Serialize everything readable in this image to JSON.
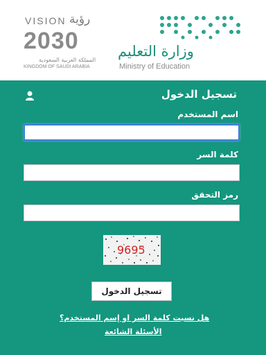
{
  "header": {
    "vision_word": "VISION",
    "vision_arabic": "رؤية",
    "vision_year": "2030",
    "kingdom_arabic": "المملكة العربية السعودية",
    "kingdom_english": "KINGDOM OF SAUDI ARABIA",
    "ministry_arabic": "وزارة التعليم",
    "ministry_english": "Ministry of Education"
  },
  "login": {
    "title": "تسجيل الدخول",
    "username_label": "اسم المستخدم",
    "username_value": "",
    "password_label": "كلمة السر",
    "password_value": "",
    "captcha_label": "رمز التحقق",
    "captcha_value": "",
    "captcha_code": "9695",
    "submit_label": "تسجيل الدخول",
    "forgot_link": "هل نسيت كلمة السر او إسم المستخدم؟",
    "faq_link": "الأسئلة الشائعة"
  },
  "colors": {
    "panel_bg": "#14967f",
    "brand_green": "#1a8f7a",
    "captcha_text": "#d42020"
  },
  "icons": {
    "user": "user-icon"
  }
}
